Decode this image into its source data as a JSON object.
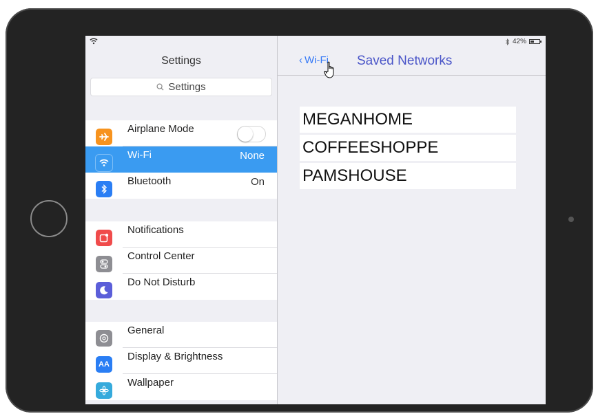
{
  "status_bar": {
    "battery_text": "42%",
    "battery_level": 0.42
  },
  "master": {
    "title": "Settings",
    "search_placeholder": "Settings",
    "groups": [
      {
        "items": [
          {
            "label": "Airplane Mode",
            "value": "",
            "icon": "airplane-icon",
            "color": "#f7931e",
            "toggle": false
          },
          {
            "label": "Wi-Fi",
            "value": "None",
            "icon": "wifi-icon",
            "color": "#3a9bf1",
            "selected": true
          },
          {
            "label": "Bluetooth",
            "value": "On",
            "icon": "bluetooth-icon",
            "color": "#2a7ef4"
          }
        ]
      },
      {
        "items": [
          {
            "label": "Notifications",
            "icon": "notifications-icon",
            "color": "#f04b4b"
          },
          {
            "label": "Control Center",
            "icon": "control-center-icon",
            "color": "#8e8e93"
          },
          {
            "label": "Do Not Disturb",
            "icon": "moon-icon",
            "color": "#5b5ed9"
          }
        ]
      },
      {
        "items": [
          {
            "label": "General",
            "icon": "gear-icon",
            "color": "#8e8e93"
          },
          {
            "label": "Display & Brightness",
            "icon": "display-icon",
            "color": "#2a7ef4"
          },
          {
            "label": "Wallpaper",
            "icon": "wallpaper-icon",
            "color": "#35aadc"
          }
        ]
      }
    ]
  },
  "detail": {
    "back_label": "Wi-Fi",
    "title": "Saved Networks",
    "networks": [
      "MEGANHOME",
      "COFFEESHOPPE",
      "PAMSHOUSE"
    ]
  },
  "colors": {
    "accent": "#3478f6",
    "selected_row": "#3a9bf1",
    "title_color": "#4a55c8"
  }
}
